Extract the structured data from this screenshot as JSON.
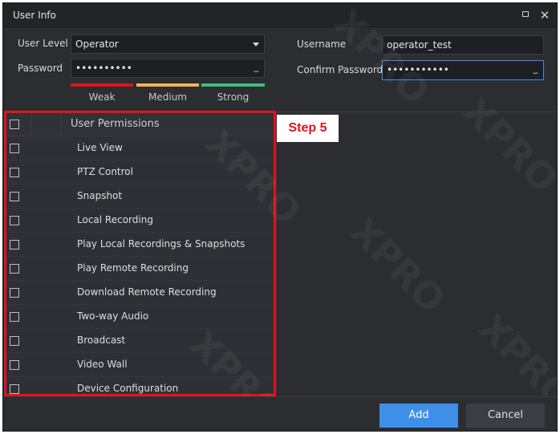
{
  "window": {
    "title": "User Info"
  },
  "form": {
    "user_level_label": "User Level",
    "user_level_value": "Operator",
    "password_label": "Password",
    "password_value": "••••••••••",
    "username_label": "Username",
    "username_value": "operator_test",
    "confirm_password_label": "Confirm Password",
    "confirm_password_value": "•••••••••••"
  },
  "strength": {
    "weak": "Weak",
    "medium": "Medium",
    "strong": "Strong",
    "colors": {
      "weak": "#e3121b",
      "medium": "#f0b455",
      "strong": "#3fbf78"
    }
  },
  "permissions": {
    "header": "User Permissions",
    "items": [
      "Live View",
      "PTZ Control",
      "Snapshot",
      "Local Recording",
      "Play Local Recordings & Snapshots",
      "Play Remote Recording",
      "Download Remote Recording",
      "Two-way Audio",
      "Broadcast",
      "Video Wall",
      "Device Configuration"
    ]
  },
  "annotation": {
    "step": "Step 5",
    "color": "#e3121b"
  },
  "buttons": {
    "add": "Add",
    "cancel": "Cancel"
  },
  "colors": {
    "accent": "#3d8fe8",
    "background": "#2b2d31"
  }
}
